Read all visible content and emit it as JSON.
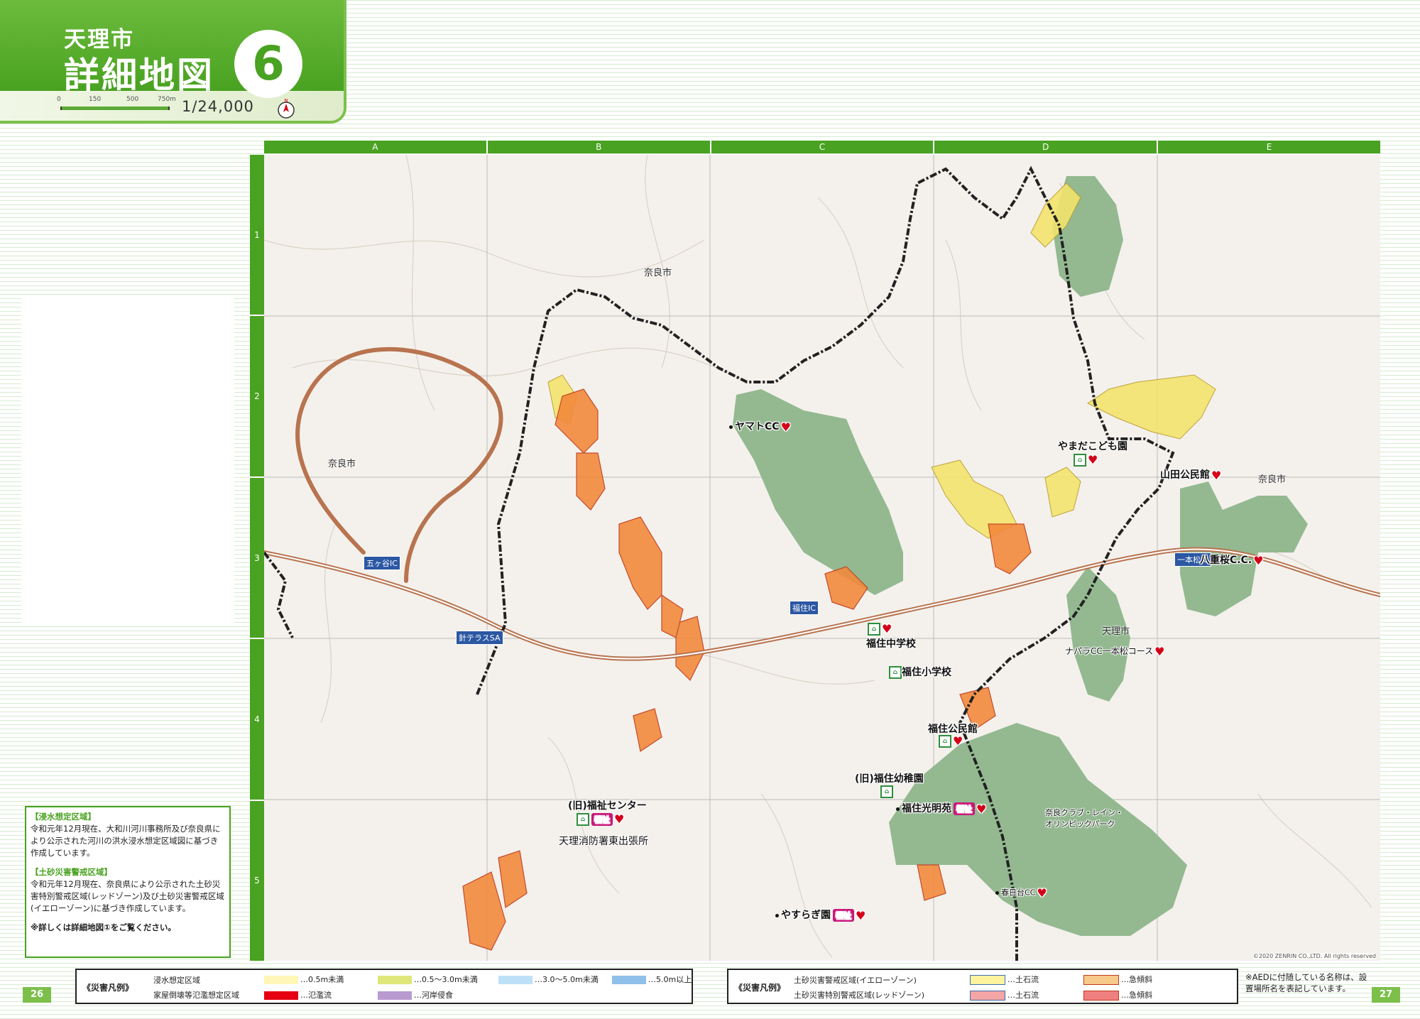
{
  "header": {
    "city": "天理市",
    "title": "詳細地図",
    "map_number": "6",
    "scale_ticks": [
      "0",
      "150",
      "500",
      "750m"
    ],
    "scale_ratio": "1/24,000",
    "north_label": "N"
  },
  "grid": {
    "columns": [
      "A",
      "B",
      "C",
      "D",
      "E"
    ],
    "rows": [
      "1",
      "2",
      "3",
      "4",
      "5"
    ]
  },
  "map_labels": {
    "yamada_kodomoen": "やまだこども園",
    "yamada_kominkan": "山田公民館",
    "yamato_cc": "ヤマトCC",
    "yae_sakura_cc": "八重桜C.C.",
    "nara_cc": "ナパラCC一本松コース",
    "fukusumi_jhs": "福住中学校",
    "fukusumi_es": "福住小学校",
    "fukusumi_kominkan": "福住公民館",
    "old_fukusumi_kindergarten": "(旧)福住幼稚園",
    "fukusumi_koumeien": "福住光明苑",
    "old_welfare_center": "(旧)福祉センター",
    "fire_station": "天理消防署東出張所",
    "yasuragien": "やすらぎ園",
    "kasugadai_cc": "春日台CC",
    "olympic_park": "奈良クラブ・レイン・オリンピックパーク",
    "fukushi_tag": "福祉",
    "aed_tag": "AED"
  },
  "city_labels": {
    "nara_1": "奈良市",
    "nara_2": "奈良市",
    "nara_3": "奈良市",
    "tenri": "天理市"
  },
  "ic_labels": {
    "gokagatani_ic": "五ヶ谷IC",
    "hariminami_sa": "針テラスSA",
    "fukusumi_ic": "福住IC",
    "ippon_matsu_ic": "一本松IC"
  },
  "copyright": "©2020 ZENRIN CO.,LTD. All rights reserved",
  "notes": {
    "flood_heading": "【浸水想定区域】",
    "flood_text": "令和元年12月現在、大和川河川事務所及び奈良県により公示された河川の洪水浸水想定区域図に基づき作成しています。",
    "landslide_heading": "【土砂災害警戒区域】",
    "landslide_text": "令和元年12月現在、奈良県により公示された土砂災害特別警戒区域(レッドゾーン)及び土砂災害警戒区域(イエローゾーン)に基づき作成しています。",
    "footnote": "※詳しくは詳細地図①をご覧ください。"
  },
  "page_numbers": {
    "left": "26",
    "right": "27"
  },
  "legend_flood": {
    "title": "《災害凡例》",
    "row1_label": "浸水想定区域",
    "row2_label": "家屋倒壊等氾濫想定区域",
    "items": [
      {
        "label": "…0.5m未満",
        "color": "#fff6b8"
      },
      {
        "label": "…0.5～3.0m未満",
        "color": "#dfe77a"
      },
      {
        "label": "…3.0～5.0m未満",
        "color": "#bfe1f7"
      },
      {
        "label": "…5.0m以上",
        "color": "#8fc0ea"
      },
      {
        "label": "…氾濫流",
        "color": "#e60012"
      },
      {
        "label": "…河岸侵食",
        "color": "#b99ad0"
      }
    ]
  },
  "legend_landslide": {
    "title": "《災害凡例》",
    "row1_label": "土砂災害警戒区域(イエローゾーン)",
    "row2_label": "土砂災害特別警戒区域(レッドゾーン)",
    "items": [
      {
        "label": "…土石流",
        "color": "#fff3a0"
      },
      {
        "label": "…急傾斜",
        "color": "#f7c98a"
      },
      {
        "label": "…土石流",
        "color": "#f5a5a5"
      },
      {
        "label": "…急傾斜",
        "color": "#f08080"
      }
    ]
  },
  "legend_note": "※AEDに付随している名称は、設置場所名を表記しています。",
  "colors": {
    "brand_green": "#49a221",
    "golf_green": "#8eb58c",
    "hazard_yellow": "#f3e46d",
    "hazard_orange": "#f28a3c",
    "expressway": "#b8734f"
  }
}
